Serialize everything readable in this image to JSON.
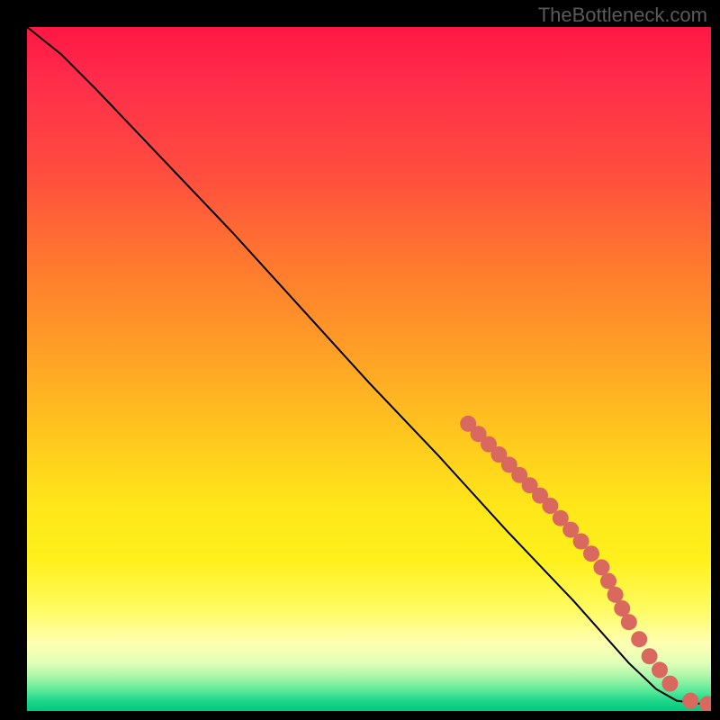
{
  "watermark": "TheBottleneck.com",
  "chart_data": {
    "type": "line",
    "title": "",
    "xlabel": "",
    "ylabel": "",
    "xlim": [
      0,
      100
    ],
    "ylim": [
      0,
      100
    ],
    "curve": [
      {
        "x": 0,
        "y": 100
      },
      {
        "x": 5,
        "y": 96
      },
      {
        "x": 10,
        "y": 91
      },
      {
        "x": 20,
        "y": 80.5
      },
      {
        "x": 30,
        "y": 70
      },
      {
        "x": 40,
        "y": 59
      },
      {
        "x": 50,
        "y": 48
      },
      {
        "x": 60,
        "y": 37.5
      },
      {
        "x": 70,
        "y": 26.5
      },
      {
        "x": 80,
        "y": 16
      },
      {
        "x": 88,
        "y": 7
      },
      {
        "x": 92,
        "y": 3.2
      },
      {
        "x": 95,
        "y": 1.5
      },
      {
        "x": 98,
        "y": 1.1
      },
      {
        "x": 100,
        "y": 1.0
      }
    ],
    "markers": [
      {
        "x": 64.5,
        "y": 42
      },
      {
        "x": 66.0,
        "y": 40.5
      },
      {
        "x": 67.5,
        "y": 39
      },
      {
        "x": 69.0,
        "y": 37.5
      },
      {
        "x": 70.5,
        "y": 36
      },
      {
        "x": 72.0,
        "y": 34.5
      },
      {
        "x": 73.5,
        "y": 33
      },
      {
        "x": 75.0,
        "y": 31.5
      },
      {
        "x": 76.5,
        "y": 30
      },
      {
        "x": 78.0,
        "y": 28.2
      },
      {
        "x": 79.5,
        "y": 26.5
      },
      {
        "x": 81.0,
        "y": 24.8
      },
      {
        "x": 82.5,
        "y": 23
      },
      {
        "x": 84.0,
        "y": 21
      },
      {
        "x": 85.0,
        "y": 19
      },
      {
        "x": 86.0,
        "y": 17
      },
      {
        "x": 87.0,
        "y": 15
      },
      {
        "x": 88.0,
        "y": 13
      },
      {
        "x": 89.5,
        "y": 10.5
      },
      {
        "x": 91.0,
        "y": 8
      },
      {
        "x": 92.5,
        "y": 6
      },
      {
        "x": 94.0,
        "y": 4
      },
      {
        "x": 97.0,
        "y": 1.5
      },
      {
        "x": 99.5,
        "y": 1.0
      }
    ],
    "marker_color": "#d9695f",
    "marker_radius": 9
  }
}
